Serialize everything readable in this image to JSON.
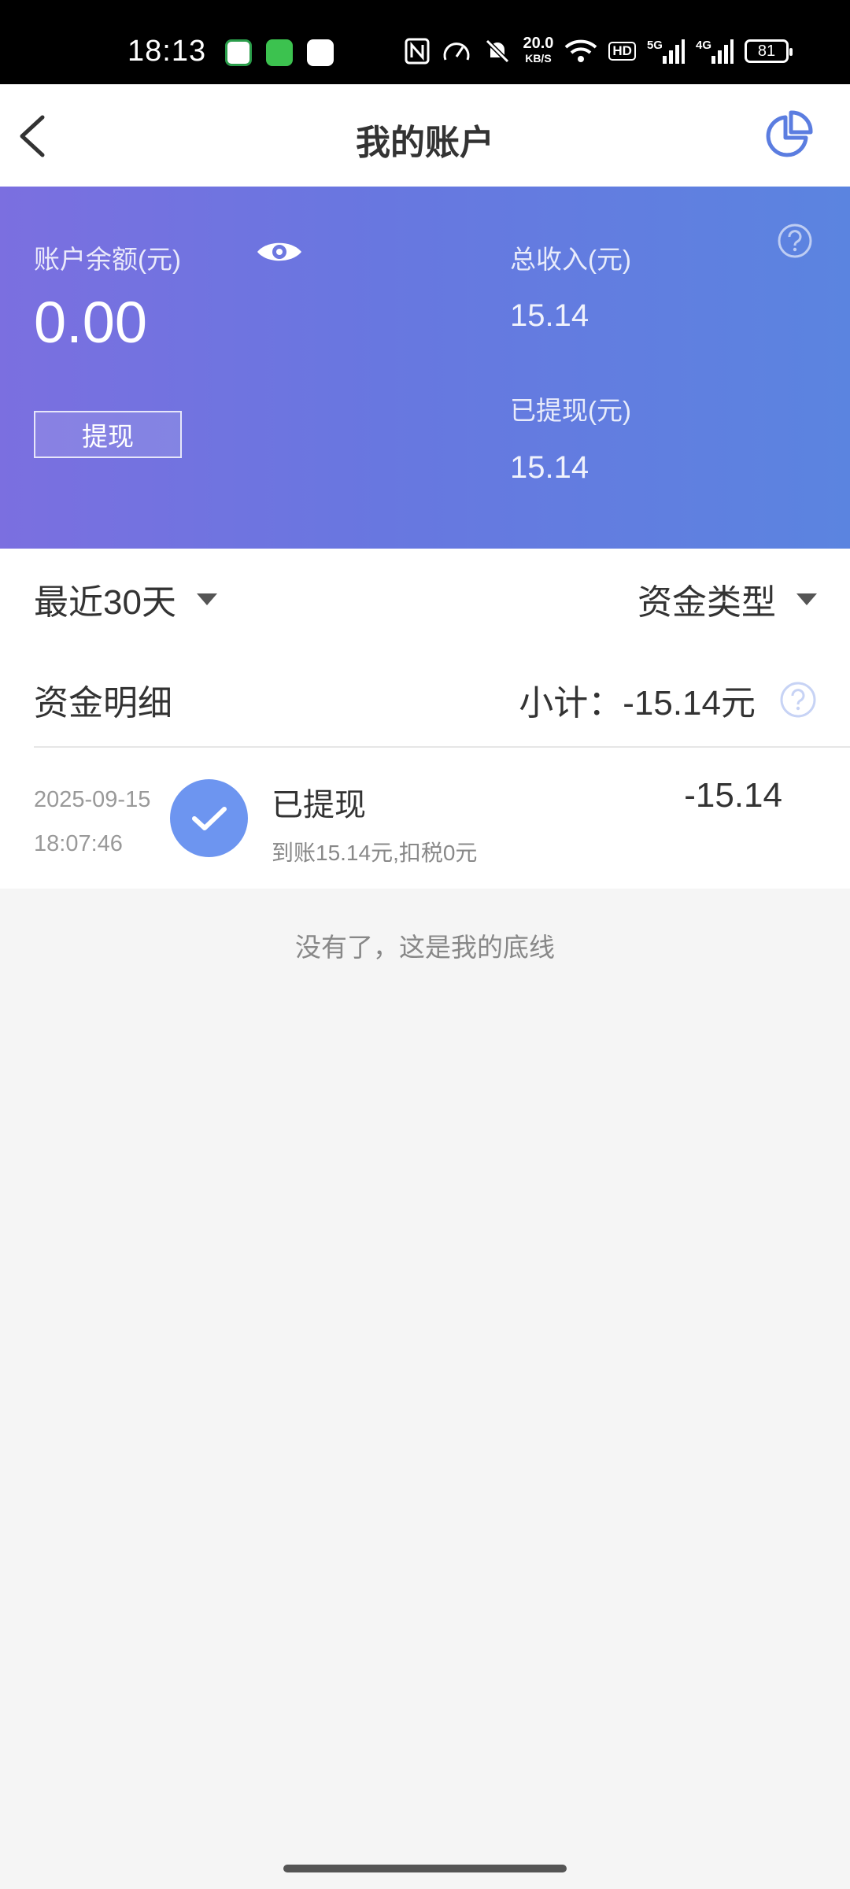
{
  "status_bar": {
    "time": "18:13",
    "net_speed_value": "20.0",
    "net_speed_unit": "KB/S",
    "signal1_label": "5G",
    "signal2_label": "4G",
    "hd_label": "HD",
    "battery": "81"
  },
  "nav": {
    "title": "我的账户"
  },
  "account": {
    "balance_label": "账户余额(元)",
    "balance_value": "0.00",
    "withdraw_button": "提现",
    "total_income_label": "总收入(元)",
    "total_income_value": "15.14",
    "withdrawn_label": "已提现(元)",
    "withdrawn_value": "15.14"
  },
  "filters": {
    "period": "最近30天",
    "fund_type": "资金类型"
  },
  "summary": {
    "title": "资金明细",
    "subtotal": "小计：-15.14元"
  },
  "transactions": [
    {
      "date": "2025-09-15",
      "time": "18:07:46",
      "title": "已提现",
      "note": "到账15.14元,扣税0元",
      "amount": "-15.14"
    }
  ],
  "end_note": "没有了，这是我的底线",
  "colors": {
    "gradient_start": "#7b6fe0",
    "gradient_end": "#5b84e0",
    "accent": "#5b7de0",
    "check_circle": "#6d95f0"
  }
}
